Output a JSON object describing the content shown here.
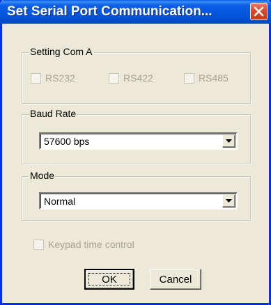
{
  "window": {
    "title": "Set Serial Port Communication..."
  },
  "setting_com": {
    "legend": "Setting Com A",
    "options": [
      {
        "label": "RS232",
        "checked": false,
        "enabled": false
      },
      {
        "label": "RS422",
        "checked": false,
        "enabled": false
      },
      {
        "label": "RS485",
        "checked": false,
        "enabled": false
      }
    ]
  },
  "baud_rate": {
    "legend": "Baud Rate",
    "selected": "57600 bps"
  },
  "mode": {
    "legend": "Mode",
    "selected": "Normal"
  },
  "keypad": {
    "label": "Keypad time control",
    "checked": false,
    "enabled": false
  },
  "buttons": {
    "ok": "OK",
    "cancel": "Cancel"
  },
  "icons": {
    "close": "close-icon",
    "dropdown": "chevron-down-icon"
  },
  "colors": {
    "titlebar": "#0a5ee8",
    "dialog_bg": "#ece9d8",
    "close_button": "#d9492b",
    "disabled_text": "#a7a394"
  }
}
